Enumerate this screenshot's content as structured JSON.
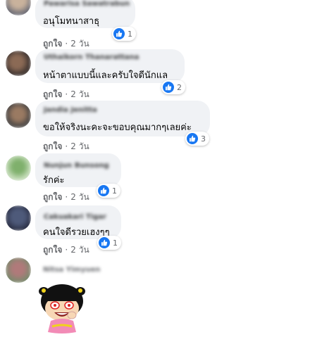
{
  "comments": [
    {
      "name": "Pawarisa Sawatrabun",
      "text": "อนุโมทนาสาธุ",
      "reaction_icon": "like-icon",
      "reaction_count": "1",
      "like_label": "ถูกใจ",
      "separator": "·",
      "time": "2 วัน"
    },
    {
      "name": "Uthaikorn Thanarattana",
      "text": "หน้าตาแบบนี้และครับใจดีนักแล",
      "reaction_icon": "like-icon",
      "reaction_count": "2",
      "like_label": "ถูกใจ",
      "separator": "·",
      "time": "2 วัน"
    },
    {
      "name": "Jandia Jenitta",
      "text": "ขอให้จริงนะคะจะขอบคุณมากๆเลยค่ะ",
      "reaction_icon": "like-icon",
      "reaction_count": "3",
      "like_label": "ถูกใจ",
      "separator": "·",
      "time": "2 วัน"
    },
    {
      "name": "Nunjun Bunsong",
      "text": "รักค่ะ",
      "reaction_icon": "like-icon",
      "reaction_count": "1",
      "like_label": "ถูกใจ",
      "separator": "·",
      "time": "2 วัน"
    },
    {
      "name": "Cakuakari Tigar",
      "text": "คนใจดีรวยเฮงๆๆ",
      "reaction_icon": "like-icon",
      "reaction_count": "1",
      "like_label": "ถูกใจ",
      "separator": "·",
      "time": "2 วัน"
    }
  ],
  "last_commenter": {
    "name": "Nitsa Yimyuen",
    "sticker": "girl-sticker"
  },
  "colors": {
    "bubble": "#f0f2f5",
    "like_blue": "#1877f2",
    "meta_gray": "#65676b"
  }
}
